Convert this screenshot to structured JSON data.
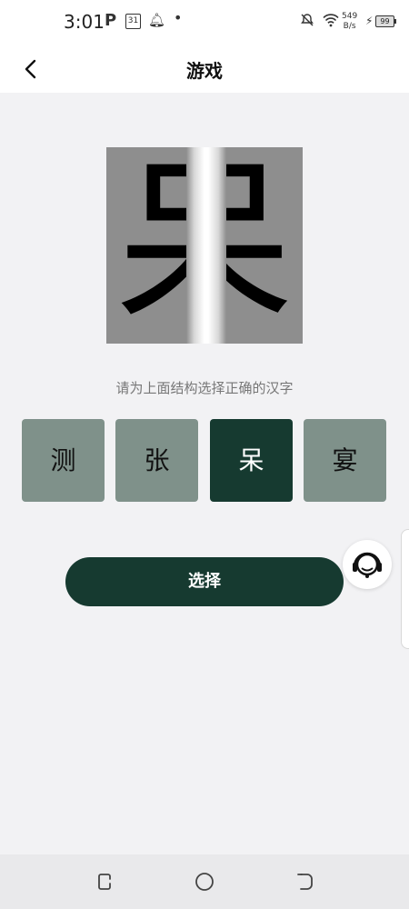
{
  "status_bar": {
    "time": "3:01",
    "p_icon": "P",
    "calendar_day": "31",
    "net_speed_value": "549",
    "net_speed_unit": "B/s",
    "battery": "99",
    "icons": [
      "parking-icon",
      "calendar-icon",
      "qq-bell-icon",
      "dot-icon",
      "mute-icon",
      "wifi-icon",
      "charging-icon",
      "battery-icon"
    ]
  },
  "header": {
    "title": "游戏",
    "back_icon": "chevron-left-icon"
  },
  "puzzle": {
    "character": "呆"
  },
  "instruction": "请为上面结构选择正确的汉字",
  "options": [
    {
      "label": "测",
      "selected": false
    },
    {
      "label": "张",
      "selected": false
    },
    {
      "label": "呆",
      "selected": true
    },
    {
      "label": "宴",
      "selected": false
    }
  ],
  "submit_label": "选择",
  "support_icon": "headset-support-icon",
  "nav": {
    "icons": [
      "recent-apps-icon",
      "home-icon",
      "back-icon"
    ]
  },
  "colors": {
    "accent": "#163a30",
    "option_unselected": "#7f918a",
    "background": "#f2f2f4"
  }
}
